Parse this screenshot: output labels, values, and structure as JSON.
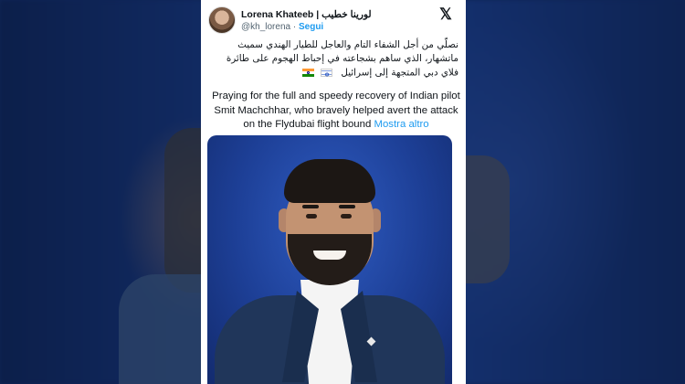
{
  "tweet": {
    "author_name": "Lorena Khateeb | لورينا خطيب",
    "author_handle": "@kh_lorena",
    "separator": "·",
    "follow_label": "Segui",
    "platform_icon": "x-logo-icon",
    "arabic_text": "نصلّي من أجل الشفاء التام والعاجل للطيار الهندي سميث ماتشهار، الذي ساهم بشجاعته في إحباط الهجوم على طائرة فلاي دبي المتجهة إلى إسرائيل",
    "flags": [
      "india-flag-icon",
      "israel-flag-icon"
    ],
    "english_text": "Praying for the full and speedy recovery of Indian pilot Smit Machchhar, who bravely helped avert the attack on the Flydubai flight bound",
    "more_label": "Mostra altro"
  },
  "colors": {
    "accent": "#1d9bf0",
    "background": "#0f2556",
    "card": "#ffffff"
  }
}
